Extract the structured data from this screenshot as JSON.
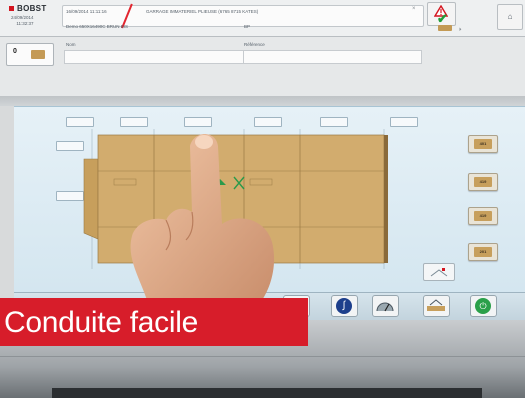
{
  "header": {
    "logo": "BOBST",
    "date": "24/09/2014",
    "time": "11:32:37",
    "info_timestamp": "16/09/2014 11:11:16",
    "product": "GARRAGE IMMATERIEL PLIEUSE (6765 8715 KATES)",
    "machine": "Demo 650X16490C BRUN BIS",
    "bp_label": "BP",
    "close_glyph": "×",
    "page_glyph": "⏵"
  },
  "form": {
    "counter_value": "0",
    "name_label": "Nom",
    "ref_label": "Référence",
    "name_value": "",
    "ref_value": ""
  },
  "side_buttons": [
    {
      "label": "401"
    },
    {
      "label": "419"
    },
    {
      "label": "419"
    },
    {
      "label": "201"
    }
  ],
  "caption": "Conduite facile",
  "colors": {
    "accent_red": "#d71d2a",
    "carton": "#d2ac6e",
    "ok_green": "#1f9e3a"
  },
  "icons": {
    "warning": "warning-triangle-icon",
    "ok": "checkmark-icon",
    "curve": "s-curve-icon",
    "power": "power-icon"
  }
}
